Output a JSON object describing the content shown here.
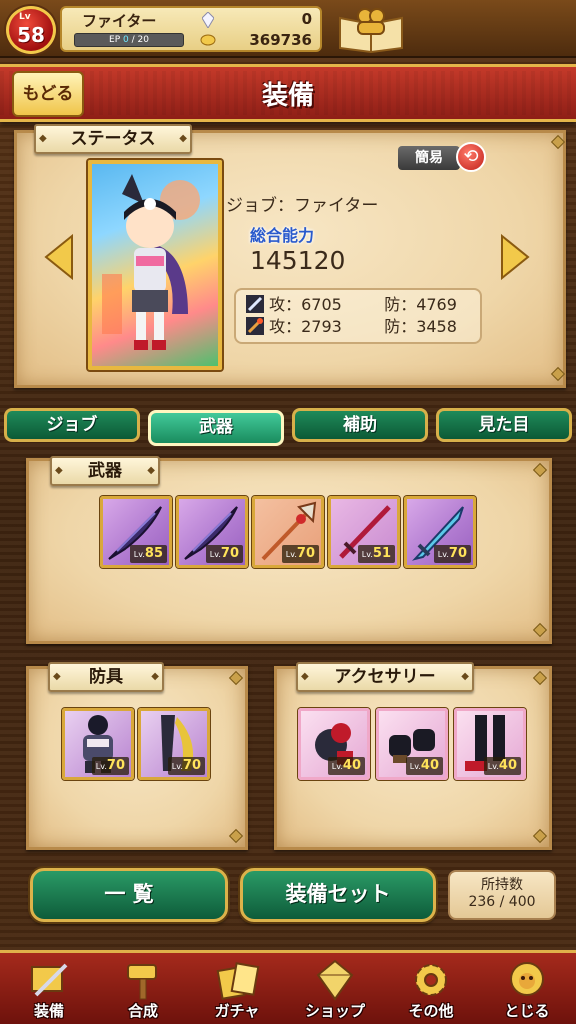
{
  "player": {
    "level_prefix": "Lv",
    "level": "58",
    "name": "ファイター",
    "ep_label": "EP",
    "ep_current": "0",
    "ep_max": "/ 20",
    "gems": "0",
    "gold": "369736"
  },
  "header": {
    "back_label": "もどる",
    "title": "装備"
  },
  "status": {
    "tag": "ステータス",
    "simple_label": "簡易",
    "job_line": "ジョブ：ファイター",
    "total_label": "総合能力",
    "total_value": "145120",
    "rows": [
      {
        "atk": "攻：6705",
        "def": "防：4769",
        "icon": "sword-icon"
      },
      {
        "atk": "攻：2793",
        "def": "防：3458",
        "icon": "staff-icon"
      }
    ]
  },
  "tabs": [
    {
      "label": "ジョブ",
      "active": false
    },
    {
      "label": "武器",
      "active": true
    },
    {
      "label": "補助",
      "active": false
    },
    {
      "label": "見た目",
      "active": false
    }
  ],
  "weapons": {
    "tag": "武器",
    "items": [
      {
        "level": "85",
        "icon": "dark-feather-sword-icon"
      },
      {
        "level": "70",
        "icon": "dark-feather-sword-icon"
      },
      {
        "level": "70",
        "icon": "axe-spear-icon"
      },
      {
        "level": "51",
        "icon": "red-sword-icon"
      },
      {
        "level": "70",
        "icon": "blue-blade-icon"
      }
    ]
  },
  "armor": {
    "tag": "防具",
    "items": [
      {
        "level": "70",
        "icon": "dark-armor-icon"
      },
      {
        "level": "70",
        "icon": "leg-armor-icon"
      }
    ]
  },
  "accessory": {
    "tag": "アクセサリー",
    "items": [
      {
        "level": "40",
        "icon": "pirate-accessory-icon"
      },
      {
        "level": "40",
        "icon": "black-gloves-icon"
      },
      {
        "level": "40",
        "icon": "black-boots-icon"
      }
    ]
  },
  "actions": {
    "list_label": "一 覧",
    "set_label": "装備セット",
    "owned_label": "所持数",
    "owned_value": "236 / 400"
  },
  "lv_small": "Lv.",
  "nav": [
    {
      "label": "装備",
      "icon": "equipment-icon"
    },
    {
      "label": "合成",
      "icon": "hammer-icon"
    },
    {
      "label": "ガチャ",
      "icon": "gacha-icon"
    },
    {
      "label": "ショップ",
      "icon": "crystal-shop-icon"
    },
    {
      "label": "その他",
      "icon": "gear-icon"
    },
    {
      "label": "とじる",
      "icon": "close-lion-icon"
    }
  ],
  "colors": {
    "accent_red": "#a52a1c",
    "tab_green": "#1a8c5e",
    "gold_border": "#dcb24a",
    "parchment": "#efd6a8",
    "total_label_blue": "#2a5acc",
    "level_yellow": "#ffe35a"
  }
}
